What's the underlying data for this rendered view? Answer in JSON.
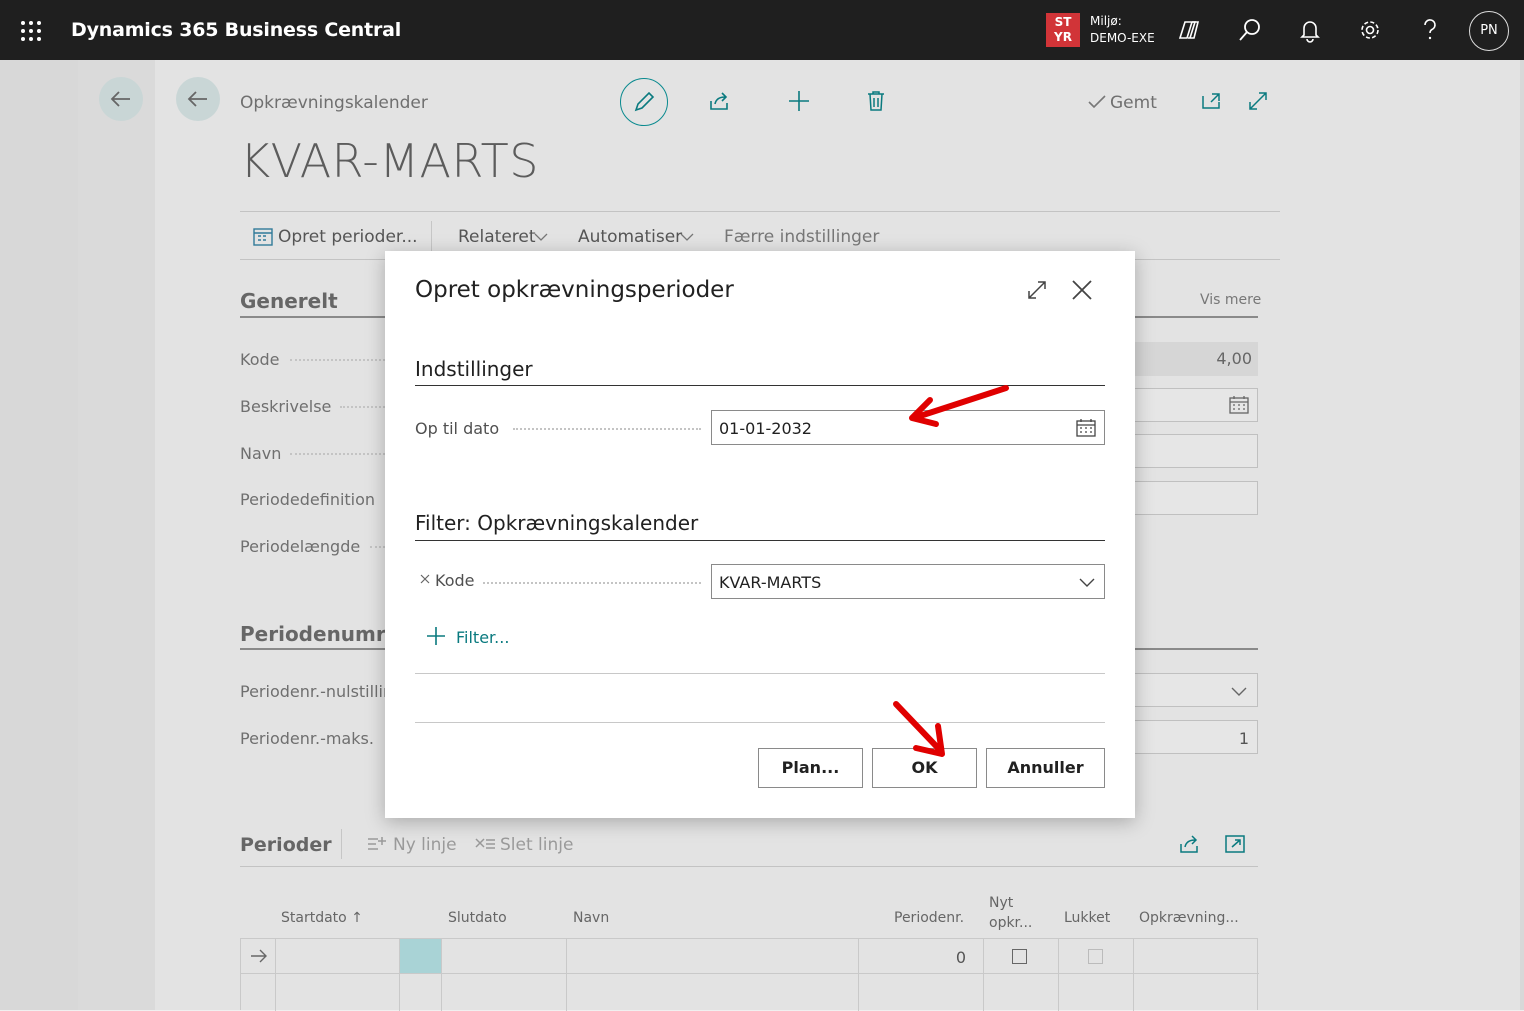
{
  "topbar": {
    "app_title": "Dynamics 365 Business Central",
    "env_badge_line1": "ST",
    "env_badge_line2": "YR",
    "env_label": "Miljø:",
    "env_name": "DEMO-EXE",
    "avatar_initials": "PN"
  },
  "page": {
    "breadcrumb": "Opkrævningskalender",
    "title": "KVAR-MARTS",
    "saved_label": "Gemt",
    "actions": {
      "create_periods": "Opret perioder...",
      "related": "Relateret",
      "automate": "Automatiser",
      "fewer_options": "Færre indstillinger"
    },
    "general": {
      "heading": "Generelt",
      "show_more": "Vis mere",
      "fields": [
        "Kode",
        "Beskrivelse",
        "Navn",
        "Periodedefinition",
        "Periodelængde"
      ],
      "period_length_value": "4,00"
    },
    "period_numbers": {
      "heading": "Periodenumre",
      "fields": [
        "Periodenr.-nulstilling",
        "Periodenr.-maks."
      ],
      "max_value": "1"
    },
    "periods": {
      "heading": "Perioder",
      "new_line": "Ny linje",
      "delete_line": "Slet linje",
      "columns": [
        "Startdato ↑",
        "Slutdato",
        "Navn",
        "Periodenr.",
        "Nyt opkr...",
        "Lukket",
        "Opkrævning..."
      ],
      "row_period_no": "0"
    }
  },
  "dialog": {
    "title": "Opret opkrævningsperioder",
    "settings_heading": "Indstillinger",
    "up_to_date_label": "Op til dato",
    "up_to_date_value": "01-01-2032",
    "filter_heading": "Filter: Opkrævningskalender",
    "filter_field_label": "Kode",
    "filter_field_value": "KVAR-MARTS",
    "add_filter_label": "Filter...",
    "buttons": {
      "plan": "Plan...",
      "ok": "OK",
      "cancel": "Annuller"
    }
  },
  "colors": {
    "topbar": "#1f1f1f",
    "accent": "#008489",
    "env_badge": "#d13438",
    "annotation_arrow": "#e00000"
  }
}
